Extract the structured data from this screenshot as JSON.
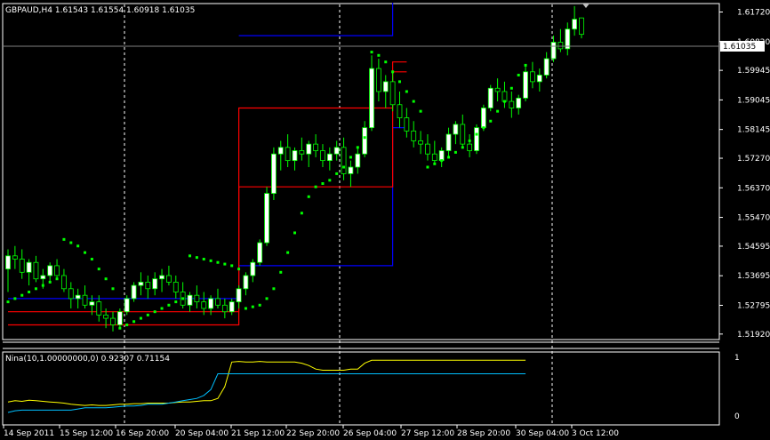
{
  "header": {
    "symbol_line": "GBPAUD,H4  1.61543 1.61554 1.60918 1.61035"
  },
  "indicator": {
    "title": "Nina(10,1.00000000,0) 0.92307 0.71154",
    "scale_top": "1",
    "scale_bottom": "0"
  },
  "price_marker": "1.61035",
  "colors": {
    "background": "#000000",
    "bull_candle": "#ffffff",
    "bear_candle": "#000000",
    "wick": "#00ff00",
    "sar": "#00ff00",
    "upper_band": "#0000ff",
    "lower_band": "#ff0000",
    "ind_line1": "#ffff00",
    "ind_line2": "#00bfff"
  },
  "chart_data": [
    {
      "type": "candlestick",
      "title": "GBPAUD,H4",
      "price_axis_ticks": [
        "1.61720",
        "1.60820",
        "1.59945",
        "1.59045",
        "1.58145",
        "1.57270",
        "1.56370",
        "1.55470",
        "1.54595",
        "1.53695",
        "1.52795",
        "1.51920"
      ],
      "ylim": [
        1.5178,
        1.6195
      ],
      "time_axis_ticks": [
        "14 Sep 2011",
        "15 Sep 12:00",
        "16 Sep 20:00",
        "20 Sep 04:00",
        "21 Sep 12:00",
        "22 Sep 20:00",
        "26 Sep 04:00",
        "27 Sep 12:00",
        "28 Sep 20:00",
        "30 Sep 04:00",
        "3 Oct 12:00"
      ],
      "last_price": 1.61035,
      "candles": [
        [
          1.539,
          1.545,
          1.532,
          1.543
        ],
        [
          1.543,
          1.546,
          1.539,
          1.542
        ],
        [
          1.542,
          1.545,
          1.536,
          1.538
        ],
        [
          1.538,
          1.542,
          1.534,
          1.541
        ],
        [
          1.541,
          1.543,
          1.535,
          1.536
        ],
        [
          1.536,
          1.539,
          1.533,
          1.537
        ],
        [
          1.537,
          1.541,
          1.535,
          1.54
        ],
        [
          1.54,
          1.542,
          1.536,
          1.537
        ],
        [
          1.537,
          1.539,
          1.532,
          1.533
        ],
        [
          1.533,
          1.535,
          1.527,
          1.53
        ],
        [
          1.53,
          1.533,
          1.527,
          1.531
        ],
        [
          1.531,
          1.534,
          1.527,
          1.528
        ],
        [
          1.528,
          1.531,
          1.525,
          1.529
        ],
        [
          1.529,
          1.531,
          1.523,
          1.525
        ],
        [
          1.525,
          1.527,
          1.521,
          1.524
        ],
        [
          1.524,
          1.526,
          1.52,
          1.522
        ],
        [
          1.522,
          1.527,
          1.521,
          1.526
        ],
        [
          1.526,
          1.531,
          1.525,
          1.53
        ],
        [
          1.53,
          1.535,
          1.529,
          1.534
        ],
        [
          1.534,
          1.538,
          1.531,
          1.535
        ],
        [
          1.535,
          1.537,
          1.53,
          1.533
        ],
        [
          1.533,
          1.538,
          1.531,
          1.536
        ],
        [
          1.536,
          1.539,
          1.532,
          1.537
        ],
        [
          1.537,
          1.54,
          1.534,
          1.535
        ],
        [
          1.535,
          1.537,
          1.53,
          1.532
        ],
        [
          1.532,
          1.535,
          1.527,
          1.528
        ],
        [
          1.528,
          1.532,
          1.526,
          1.531
        ],
        [
          1.531,
          1.534,
          1.527,
          1.529
        ],
        [
          1.529,
          1.532,
          1.525,
          1.527
        ],
        [
          1.527,
          1.531,
          1.525,
          1.53
        ],
        [
          1.53,
          1.533,
          1.527,
          1.528
        ],
        [
          1.528,
          1.53,
          1.524,
          1.526
        ],
        [
          1.526,
          1.53,
          1.525,
          1.529
        ],
        [
          1.529,
          1.534,
          1.527,
          1.533
        ],
        [
          1.533,
          1.538,
          1.531,
          1.537
        ],
        [
          1.537,
          1.542,
          1.535,
          1.541
        ],
        [
          1.541,
          1.548,
          1.54,
          1.547
        ],
        [
          1.547,
          1.564,
          1.546,
          1.562
        ],
        [
          1.562,
          1.576,
          1.56,
          1.574
        ],
        [
          1.574,
          1.578,
          1.569,
          1.576
        ],
        [
          1.576,
          1.58,
          1.57,
          1.572
        ],
        [
          1.572,
          1.576,
          1.569,
          1.575
        ],
        [
          1.575,
          1.579,
          1.572,
          1.574
        ],
        [
          1.574,
          1.578,
          1.57,
          1.577
        ],
        [
          1.577,
          1.58,
          1.573,
          1.575
        ],
        [
          1.575,
          1.577,
          1.57,
          1.572
        ],
        [
          1.572,
          1.576,
          1.569,
          1.574
        ],
        [
          1.574,
          1.578,
          1.572,
          1.576
        ],
        [
          1.576,
          1.579,
          1.566,
          1.568
        ],
        [
          1.568,
          1.572,
          1.564,
          1.57
        ],
        [
          1.57,
          1.576,
          1.568,
          1.574
        ],
        [
          1.574,
          1.584,
          1.573,
          1.582
        ],
        [
          1.582,
          1.604,
          1.581,
          1.6
        ],
        [
          1.6,
          1.603,
          1.59,
          1.593
        ],
        [
          1.593,
          1.598,
          1.588,
          1.596
        ],
        [
          1.596,
          1.599,
          1.587,
          1.589
        ],
        [
          1.589,
          1.593,
          1.582,
          1.585
        ],
        [
          1.585,
          1.588,
          1.579,
          1.581
        ],
        [
          1.581,
          1.584,
          1.576,
          1.578
        ],
        [
          1.578,
          1.581,
          1.574,
          1.577
        ],
        [
          1.577,
          1.58,
          1.572,
          1.574
        ],
        [
          1.574,
          1.578,
          1.571,
          1.572
        ],
        [
          1.572,
          1.576,
          1.57,
          1.575
        ],
        [
          1.575,
          1.582,
          1.573,
          1.58
        ],
        [
          1.58,
          1.584,
          1.577,
          1.583
        ],
        [
          1.583,
          1.586,
          1.576,
          1.577
        ],
        [
          1.577,
          1.58,
          1.573,
          1.575
        ],
        [
          1.575,
          1.583,
          1.574,
          1.582
        ],
        [
          1.582,
          1.589,
          1.581,
          1.588
        ],
        [
          1.588,
          1.595,
          1.587,
          1.594
        ],
        [
          1.594,
          1.597,
          1.59,
          1.593
        ],
        [
          1.593,
          1.596,
          1.588,
          1.59
        ],
        [
          1.59,
          1.593,
          1.585,
          1.588
        ],
        [
          1.588,
          1.592,
          1.586,
          1.591
        ],
        [
          1.591,
          1.601,
          1.59,
          1.599
        ],
        [
          1.599,
          1.602,
          1.594,
          1.596
        ],
        [
          1.596,
          1.6,
          1.593,
          1.598
        ],
        [
          1.598,
          1.605,
          1.597,
          1.603
        ],
        [
          1.603,
          1.61,
          1.602,
          1.608
        ],
        [
          1.608,
          1.612,
          1.605,
          1.606
        ],
        [
          1.606,
          1.614,
          1.604,
          1.612
        ],
        [
          1.612,
          1.619,
          1.61,
          1.615
        ],
        [
          1.6154,
          1.6155,
          1.6092,
          1.6104
        ]
      ],
      "parabolic_sar": [
        1.529,
        1.53,
        1.531,
        1.532,
        1.533,
        1.534,
        1.535,
        1.536,
        1.548,
        1.547,
        1.546,
        1.544,
        1.542,
        1.539,
        1.536,
        1.533,
        1.521,
        1.522,
        1.523,
        1.524,
        1.525,
        1.526,
        1.527,
        1.528,
        1.529,
        1.53,
        1.543,
        1.5425,
        1.542,
        1.5415,
        1.541,
        1.5405,
        1.54,
        1.539,
        1.527,
        1.5275,
        1.528,
        1.53,
        1.533,
        1.538,
        1.544,
        1.55,
        1.556,
        1.561,
        1.564,
        1.565,
        1.566,
        1.568,
        1.57,
        1.573,
        1.576,
        1.579,
        1.605,
        1.604,
        1.602,
        1.599,
        1.596,
        1.593,
        1.59,
        1.587,
        1.57,
        1.571,
        1.572,
        1.573,
        1.5745,
        1.576,
        1.578,
        1.58,
        1.582,
        1.584,
        1.587,
        1.59,
        1.594,
        1.598,
        1.601
      ],
      "upper_band_steps": [
        [
          0,
          1.53
        ],
        [
          33,
          1.53
        ],
        [
          33,
          1.61
        ],
        [
          55,
          1.61
        ],
        [
          55,
          1.62
        ]
      ],
      "mid_band_steps": [
        [
          0,
          1.526
        ],
        [
          33,
          1.526
        ],
        [
          33,
          1.588
        ],
        [
          55,
          1.588
        ],
        [
          55,
          1.602
        ]
      ],
      "lower_band_steps": [
        [
          0,
          1.522
        ],
        [
          33,
          1.522
        ],
        [
          33,
          1.564
        ],
        [
          55,
          1.564
        ],
        [
          55,
          1.599
        ]
      ],
      "band_extra": {
        "upper_after": 1.582,
        "lower_start": 1.54
      }
    },
    {
      "type": "line",
      "title": "Nina(10,1.00000000,0)",
      "ylim": [
        0,
        1
      ],
      "series": [
        {
          "name": "line1",
          "values": [
            0.24,
            0.26,
            0.25,
            0.27,
            0.26,
            0.25,
            0.24,
            0.23,
            0.22,
            0.2,
            0.19,
            0.18,
            0.19,
            0.18,
            0.18,
            0.19,
            0.2,
            0.2,
            0.21,
            0.21,
            0.22,
            0.22,
            0.22,
            0.22,
            0.23,
            0.24,
            0.24,
            0.25,
            0.26,
            0.26,
            0.3,
            0.5,
            0.92,
            0.93,
            0.92,
            0.92,
            0.93,
            0.92,
            0.92,
            0.92,
            0.92,
            0.92,
            0.9,
            0.86,
            0.8,
            0.78,
            0.78,
            0.78,
            0.78,
            0.8,
            0.8,
            0.9,
            0.95,
            0.95,
            0.95,
            0.95,
            0.95,
            0.95,
            0.95,
            0.95,
            0.95,
            0.95,
            0.95,
            0.95,
            0.95,
            0.95,
            0.95,
            0.95,
            0.95,
            0.95,
            0.95,
            0.95,
            0.95,
            0.95,
            0.95
          ]
        },
        {
          "name": "line2",
          "values": [
            0.06,
            0.09,
            0.1,
            0.1,
            0.1,
            0.1,
            0.1,
            0.1,
            0.1,
            0.1,
            0.12,
            0.14,
            0.14,
            0.14,
            0.14,
            0.15,
            0.16,
            0.17,
            0.17,
            0.18,
            0.2,
            0.2,
            0.2,
            0.22,
            0.24,
            0.26,
            0.28,
            0.3,
            0.35,
            0.45,
            0.72,
            0.72,
            0.72,
            0.72,
            0.72,
            0.72,
            0.72,
            0.72,
            0.72,
            0.72,
            0.72,
            0.72,
            0.72,
            0.72,
            0.72,
            0.72,
            0.72,
            0.72,
            0.72,
            0.72,
            0.72,
            0.72,
            0.72,
            0.72,
            0.72,
            0.72,
            0.72,
            0.72,
            0.72,
            0.72,
            0.72,
            0.72,
            0.72,
            0.72,
            0.72,
            0.72,
            0.72,
            0.72,
            0.72,
            0.72,
            0.72,
            0.72,
            0.72,
            0.72,
            0.72
          ]
        }
      ]
    }
  ]
}
